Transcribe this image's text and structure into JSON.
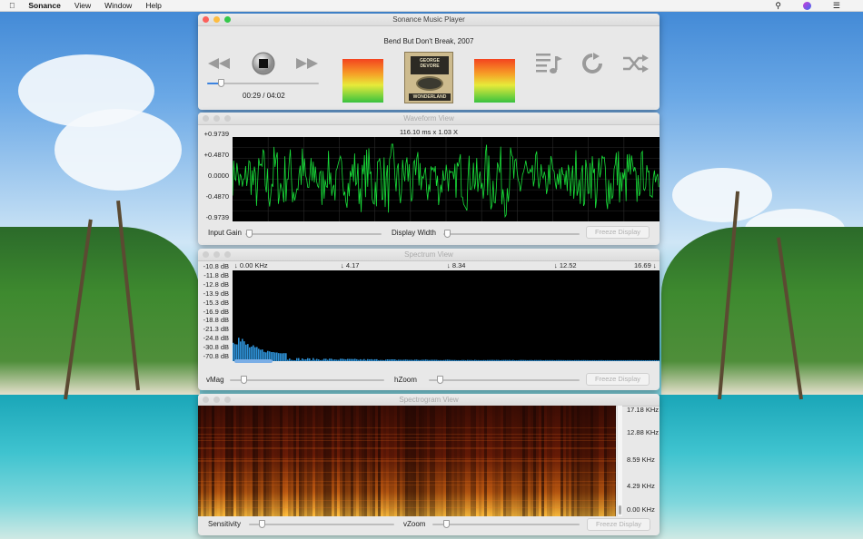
{
  "menubar": {
    "apple": "",
    "app": "Sonance",
    "items": [
      "View",
      "Window",
      "Help"
    ]
  },
  "player": {
    "window_title": "Sonance Music Player",
    "song": "Bend But Don't Break, 2007",
    "time": "00:29 / 04:02",
    "progress": 0.12,
    "icons": [
      "rewind-icon",
      "stop-icon",
      "fast-forward-icon",
      "playlist-icon",
      "repeat-icon",
      "shuffle-icon"
    ],
    "album_art": {
      "top_text": "GEORGE DEVORE",
      "bottom_text": "WONDERLAND"
    }
  },
  "waveform": {
    "window_title": "Waveform View",
    "scale": "116.10 ms x 1.03 X",
    "y_labels": [
      "+0.9739",
      "+0.4870",
      "0.0000",
      "-0.4870",
      "-0.9739"
    ],
    "input_gain_label": "Input Gain",
    "display_width_label": "Display Width",
    "freeze_label": "Freeze Display"
  },
  "spectrum": {
    "window_title": "Spectrum View",
    "freq_labels": [
      "↓ 0.00 KHz",
      "↓ 4.17",
      "↓ 8.34",
      "↓ 12.52",
      "16.69 ↓"
    ],
    "db_labels": [
      "-10.8 dB",
      "-11.8 dB",
      "-12.8 dB",
      "-13.9 dB",
      "-15.3 dB",
      "-16.9 dB",
      "-18.8 dB",
      "-21.3 dB",
      "-24.8 dB",
      "-30.8 dB",
      "-70.8 dB"
    ],
    "vmag_label": "vMag",
    "hzoom_label": "hZoom",
    "freeze_label": "Freeze Display"
  },
  "spectrogram": {
    "window_title": "Spectrogram View",
    "freq_labels": [
      "17.18 KHz",
      "12.88 KHz",
      "8.59 KHz",
      "4.29 KHz",
      "0.00 KHz"
    ],
    "sensitivity_label": "Sensitivity",
    "vzoom_label": "vZoom",
    "freeze_label": "Freeze Display"
  },
  "colors": {
    "waveform": "#19e03a",
    "spectrum": "#2e93d9",
    "accent": "#3b83e0"
  }
}
